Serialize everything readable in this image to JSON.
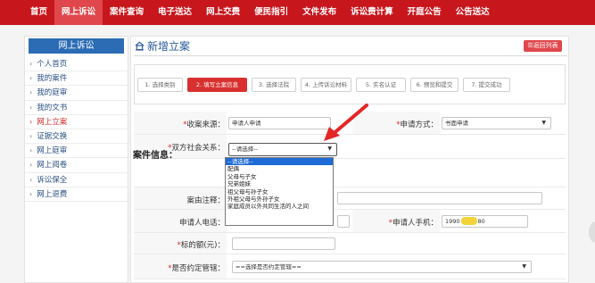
{
  "topnav": {
    "items": [
      "首页",
      "网上诉讼",
      "案件查询",
      "电子送达",
      "网上交费",
      "便民指引",
      "文件发布",
      "诉讼费计算",
      "开庭公告",
      "公告送达"
    ],
    "active_index": 1
  },
  "sidebar": {
    "header": "网上诉讼",
    "items": [
      "个人首页",
      "我的案件",
      "我的庭审",
      "我的文书",
      "网上立案",
      "证据交换",
      "网上庭审",
      "网上阅卷",
      "诉讼保全",
      "网上退费"
    ],
    "active_index": 4
  },
  "main": {
    "title": "新增立案",
    "return_label": "☰返回列表",
    "steps": [
      "1. 选择类别",
      "2. 填写立案信息",
      "3. 选择法院",
      "4. 上传诉讼材料",
      "5. 实名认证",
      "6. 预览和提交",
      "7. 提交成功"
    ],
    "active_step": 1
  },
  "form": {
    "source_label": "*收案来源：",
    "source_value": "申请人申请",
    "method_label": "*申请方式：",
    "method_value": "书面申请",
    "relation_label": "*双方社会关系：",
    "relation_value": "--请选择--",
    "relation_options": [
      "--请选择--",
      "配偶",
      "父母与子女",
      "兄弟姐妹",
      "祖父母与孙子女",
      "外祖父母与外孙子女",
      "家庭成员以外共同生活的人之间"
    ],
    "relation_highlighted": 0,
    "section_case_info": "案件信息：",
    "note_label": "案由注释：",
    "phone_label": "申请人电话：",
    "mobile_label": "*申请人手机：",
    "mobile_value": "1990",
    "mobile_suffix": "80",
    "amount_label": "*标的额(元)：",
    "jurisdiction_label": "*是否约定管辖：",
    "jurisdiction_value": "==选择是否约定管辖=="
  },
  "colors": {
    "nav_red": "#c8161d",
    "nav_active": "#e0474c",
    "sidebar_head": "#2b6cb4",
    "step_active": "#d83030",
    "link_blue": "#2a4f83",
    "highlight_blue": "#1e6ad6",
    "mask_yellow": "#f2d43a"
  },
  "icons": {
    "title": "home-icon",
    "sidebar_chevron": "chevron-right-icon",
    "select_caret": "caret-down-icon",
    "annotation": "red-arrow-icon"
  }
}
